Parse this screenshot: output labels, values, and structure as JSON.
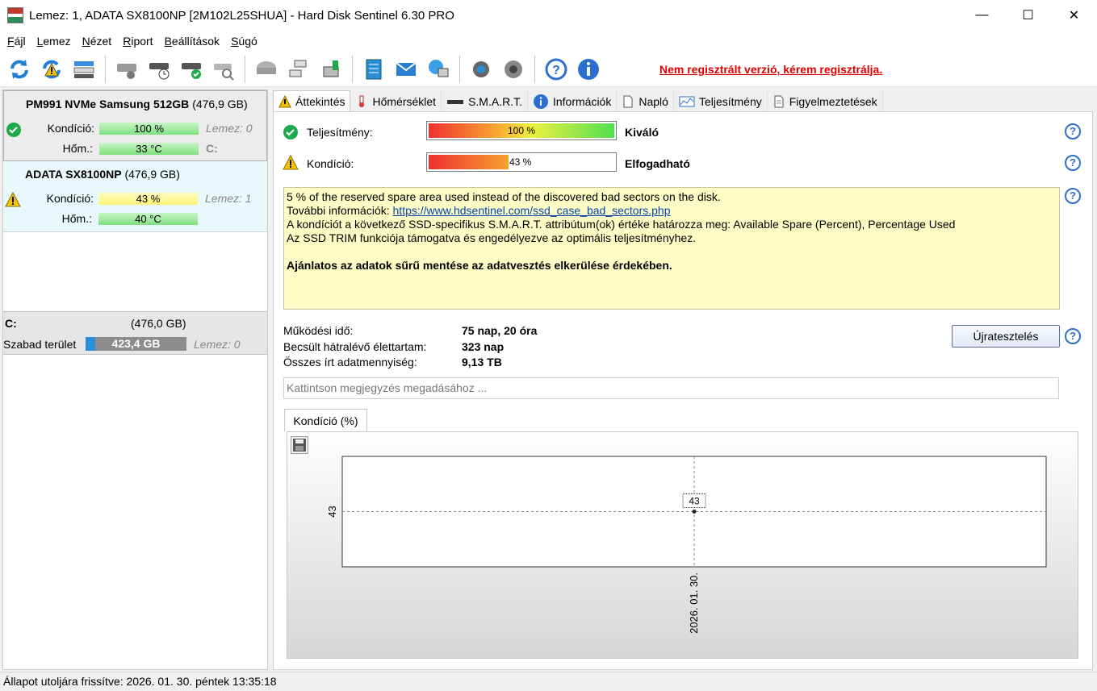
{
  "window": {
    "title": "Lemez: 1, ADATA SX8100NP [2M102L25SHUA]  -  Hard Disk Sentinel 6.30 PRO",
    "minimize": "—",
    "maximize": "☐",
    "close": "✕"
  },
  "menu": [
    {
      "ul": "F",
      "rest": "ájl"
    },
    {
      "ul": "L",
      "rest": "emez"
    },
    {
      "ul": "N",
      "rest": "ézet"
    },
    {
      "ul": "R",
      "rest": "iport"
    },
    {
      "ul": "B",
      "rest": "eállítások"
    },
    {
      "ul": "S",
      "rest": "úgó"
    }
  ],
  "toolbar": {
    "registration_notice": "Nem regisztrált verzió, kérem regisztrálja."
  },
  "disks": [
    {
      "name": "PM991 NVMe Samsung 512GB",
      "size": "(476,9 GB)",
      "condition_label": "Kondíció:",
      "condition": "100 %",
      "temp_label": "Hőm.:",
      "temp": "33 °C",
      "disk_index": "Lemez: 0",
      "drive_letter": "C:"
    },
    {
      "name": "ADATA SX8100NP",
      "size": "(476,9 GB)",
      "condition_label": "Kondíció:",
      "condition": "43 %",
      "temp_label": "Hőm.:",
      "temp": "40 °C",
      "disk_index": "Lemez: 1"
    }
  ],
  "volume": {
    "letter": "C:",
    "size": "(476,0 GB)",
    "free_label": "Szabad terület",
    "free": "423,4 GB",
    "disk_index": "Lemez: 0"
  },
  "tabs": [
    "Áttekintés",
    "Hőmérséklet",
    "S.M.A.R.T.",
    "Információk",
    "Napló",
    "Teljesítmény",
    "Figyelmeztetések"
  ],
  "overview": {
    "performance_label": "Teljesítmény:",
    "performance_value": "100 %",
    "performance_percent": 100,
    "performance_word": "Kiváló",
    "condition_label": "Kondíció:",
    "condition_value": "43 %",
    "condition_percent": 43,
    "condition_word": "Elfogadható",
    "info_line1": "5 % of the reserved spare area used instead of the discovered bad sectors on the disk.",
    "info_line2_prefix": "További információk: ",
    "info_line2_link": "https://www.hdsentinel.com/ssd_case_bad_sectors.php",
    "info_line3": "A kondíciót a következő SSD-specifikus S.M.A.R.T. attribútum(ok) értéke határozza meg:  Available Spare (Percent), Percentage Used",
    "info_line4": "Az SSD TRIM funkciója támogatva és engedélyezve az optimális teljesítményhez.",
    "info_line5": "Ajánlatos az adatok sűrű mentése az adatvesztés elkerülése érdekében.",
    "uptime_label": "Működési idő:",
    "uptime": "75 nap, 20 óra",
    "lifetime_label": "Becsült hátralévő élettartam:",
    "lifetime": "323 nap",
    "written_label": "Összes írt adatmennyiség:",
    "written": "9,13 TB",
    "retest_button": "Újratesztelés",
    "note_placeholder": "Kattintson megjegyzés megadásához ...",
    "chart_tab": "Kondíció  (%)",
    "help": "?"
  },
  "chart_data": {
    "type": "line",
    "x": [
      "2026. 01. 30."
    ],
    "values": [
      43
    ],
    "yticks": [
      "43"
    ],
    "xticks": [
      "2026. 01. 30."
    ],
    "data_labels": [
      "43"
    ],
    "grid": true
  },
  "status": "Állapot utoljára frissítve: 2026. 01. 30. péntek 13:35:18",
  "colors": {
    "accent_blue": "#2d6fd1",
    "registration_red": "#e00000",
    "info_bg": "#fdfcc4"
  }
}
